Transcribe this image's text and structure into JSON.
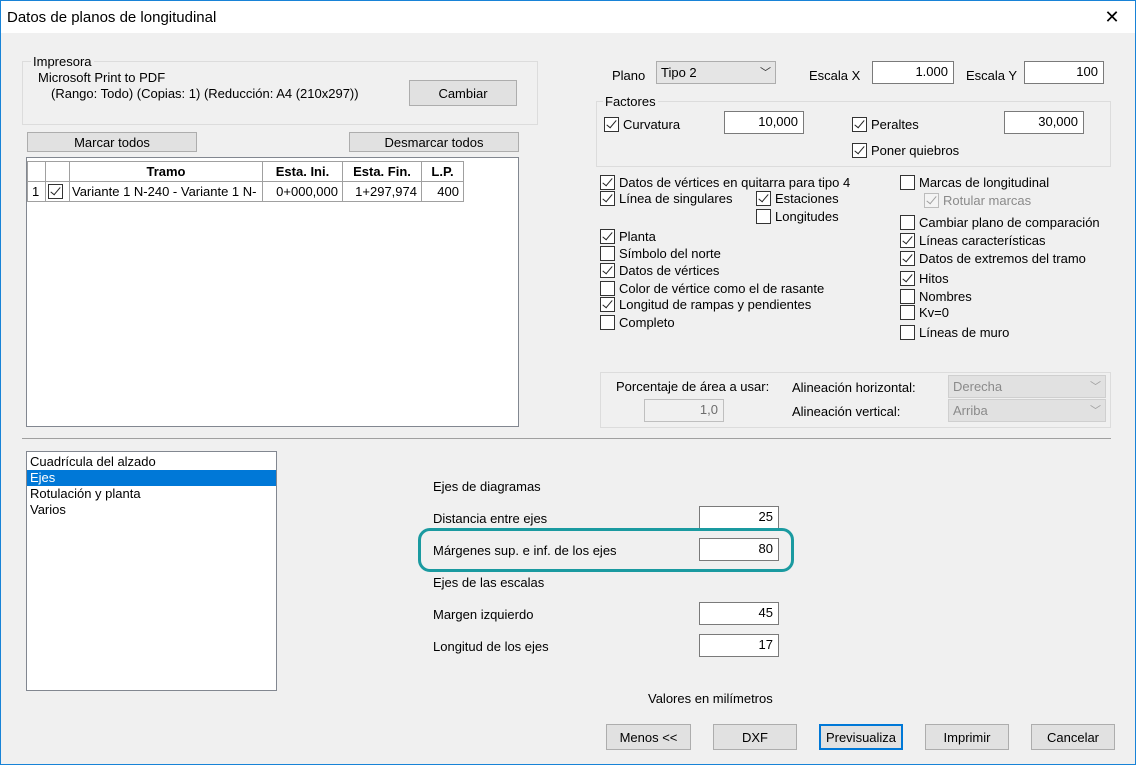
{
  "window": {
    "title": "Datos de planos de longitudinal",
    "close_icon": "close-icon"
  },
  "printer": {
    "group_label": "Impresora",
    "name": "Microsoft Print to PDF",
    "details": "(Rango: Todo) (Copias: 1) (Reducción: A4 (210x297))",
    "change_button": "Cambiar"
  },
  "table": {
    "mark_all": "Marcar todos",
    "unmark_all": "Desmarcar todos",
    "headers": [
      "",
      "",
      "Tramo",
      "Esta. Ini.",
      "Esta. Fin.",
      "L.P."
    ],
    "rows": [
      {
        "index": "1",
        "checked": true,
        "tramo": "Variante 1 N-240 - Variante 1 N-",
        "ini": "0+000,000",
        "fin": "1+297,974",
        "lp": "400"
      }
    ]
  },
  "plano": {
    "label": "Plano",
    "value": "Tipo 2",
    "escala_x_label": "Escala X",
    "escala_x": "1.000",
    "escala_y_label": "Escala Y",
    "escala_y": "100"
  },
  "factores": {
    "label": "Factores",
    "curvatura_label": "Curvatura",
    "curvatura_value": "10,000",
    "peraltes_label": "Peraltes",
    "peraltes_value": "30,000",
    "quiebros_label": "Poner quiebros"
  },
  "options": {
    "datos_vertices_guitarra": "Datos de vértices en quitarra para tipo 4",
    "linea_singulares": "Línea de singulares",
    "estaciones": "Estaciones",
    "longitudes": "Longitudes",
    "planta": "Planta",
    "simbolo_norte": "Símbolo del norte",
    "datos_vertices": "Datos de vértices",
    "color_vertice": "Color de vértice como el de rasante",
    "longitud_rampas": "Longitud de rampas y pendientes",
    "completo": "Completo",
    "marcas_longitudinal": "Marcas de longitudinal",
    "rotular_marcas": "Rotular marcas",
    "cambiar_plano": "Cambiar plano de comparación",
    "lineas_caracteristicas": "Líneas características",
    "datos_extremos": "Datos de extremos del tramo",
    "hitos": "Hitos",
    "nombres": "Nombres",
    "kv0": "Kv=0",
    "lineas_muro": "Líneas de muro"
  },
  "area": {
    "porcentaje_label": "Porcentaje de área a usar:",
    "porcentaje_value": "1,0",
    "alin_h_label": "Alineación horizontal:",
    "alin_h_value": "Derecha",
    "alin_v_label": "Alineación vertical:",
    "alin_v_value": "Arriba"
  },
  "categories": [
    "Cuadrícula del alzado",
    "Ejes",
    "Rotulación y planta",
    "Varios"
  ],
  "ejes": {
    "diagramas_title": "Ejes de diagramas",
    "distancia_label": "Distancia entre ejes",
    "distancia_value": "25",
    "margenes_label": "Márgenes sup. e inf. de los ejes",
    "margenes_value": "80",
    "escalas_title": "Ejes de las escalas",
    "margen_izq_label": "Margen izquierdo",
    "margen_izq_value": "45",
    "longitud_label": "Longitud de los ejes",
    "longitud_value": "17",
    "units_note": "Valores en milímetros"
  },
  "buttons": {
    "menos": "Menos <<",
    "dxf": "DXF",
    "previsualiza": "Previsualiza",
    "imprimir": "Imprimir",
    "cancelar": "Cancelar"
  },
  "colors": {
    "accent": "#0078d7",
    "highlight": "#1a9aa0"
  }
}
